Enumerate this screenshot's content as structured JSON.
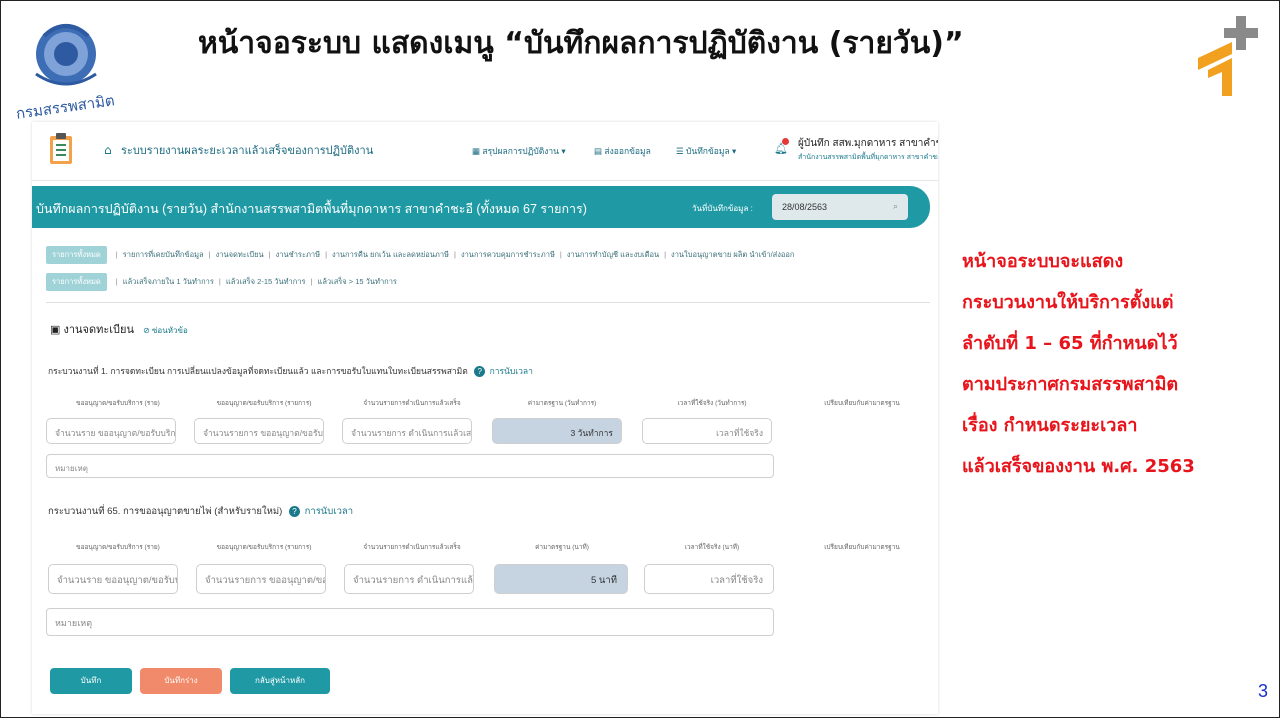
{
  "slide": {
    "title": "หน้าจอระบบ แสดงเมนู “บันทึกผลการปฏิบัติงาน (รายวัน)”",
    "seal_text": "กรมสรรพสามิต",
    "side_note": [
      "หน้าจอระบบจะแสดง",
      "กระบวนงานให้บริการตั้งแต่",
      "ลำดับที่ 1 – 65 ที่กำหนดไว้",
      "ตามประกาศกรมสรรพสามิต",
      "เรื่อง กำหนดระยะเวลา",
      "แล้วเสร็จของงาน  พ.ศ. 2563"
    ],
    "page_number": "3"
  },
  "app": {
    "system_title": "ระบบรายงานผลระยะเวลาแล้วเสร็จของการปฏิบัติงาน",
    "menu": [
      "สรุปผลการปฏิบัติงาน ▾",
      "ส่งออกข้อมูล",
      "บันทึกข้อมูล ▾"
    ],
    "user_name": "ผู้บันทึก สสพ.มุกดาหาร สาขาคำชะอี",
    "user_office": "สำนักงานสรรพสามิตพื้นที่มุกดาหาร สาขาคำชะอี",
    "banner_title": "บันทึกผลการปฏิบัติงาน (รายวัน) สำนักงานสรรพสามิตพื้นที่มุกดาหาร สาขาคำชะอี (ทั้งหมด 67 รายการ)",
    "date_label": "วันที่บันทึกข้อมูล :",
    "date_value": "28/08/2563",
    "filters_row1": [
      "รายการทั้งหมด",
      "รายการที่เคยบันทึกข้อมูล",
      "งานจดทะเบียน",
      "งานชำระภาษี",
      "งานการคืน ยกเว้น และลดหย่อนภาษี",
      "งานการควบคุมการชำระภาษี",
      "งานการทำบัญชี และงบเดือน",
      "งานใบอนุญาตขาย ผลิต นำเข้า/ส่งออก"
    ],
    "filters_row2": [
      "รายการทั้งหมด",
      "แล้วเสร็จภายใน 1 วันทำการ",
      "แล้วเสร็จ 2-15 วันทำการ",
      "แล้วเสร็จ > 15 วันทำการ"
    ],
    "section_title": "งานจดทะเบียน",
    "section_toggle": "ซ่อนหัวข้อ",
    "proc1": {
      "title": "กระบวนงานที่ 1. การจดทะเบียน การเปลี่ยนแปลงข้อมูลที่จดทะเบียนแล้ว และการขอรับใบแทนใบทะเบียนสรรพสามิต",
      "timer": "การนับเวลา",
      "headers": [
        "ขออนุญาต/ขอรับบริการ (ราย)",
        "ขออนุญาต/ขอรับบริการ (รายการ)",
        "จำนวนรายการดำเนินการแล้วเสร็จ",
        "ค่ามาตรฐาน (วันทำการ)",
        "เวลาที่ใช้จริง (วันทำการ)",
        "เปรียบเทียบกับค่ามาตรฐาน"
      ],
      "placeholders": [
        "จำนวนราย ขออนุญาต/ขอรับบริการ",
        "จำนวนรายการ ขออนุญาต/ขอรับบริการ",
        "จำนวนรายการ ดำเนินการแล้วเสร็จ"
      ],
      "standard": "3 วันทำการ",
      "actual_placeholder": "เวลาที่ใช้จริง",
      "note_placeholder": "หมายเหตุ"
    },
    "proc65": {
      "title": "กระบวนงานที่ 65. การขออนุญาตขายไพ่ (สำหรับรายใหม่)",
      "timer": "การนับเวลา",
      "headers": [
        "ขออนุญาต/ขอรับบริการ (ราย)",
        "ขออนุญาต/ขอรับบริการ (รายการ)",
        "จำนวนรายการดำเนินการแล้วเสร็จ",
        "ค่ามาตรฐาน (นาที)",
        "เวลาที่ใช้จริง (นาที)",
        "เปรียบเทียบกับค่ามาตรฐาน"
      ],
      "placeholders": [
        "จำนวนราย ขออนุญาต/ขอรับบริการ",
        "จำนวนรายการ ขออนุญาต/ขอรับบริการ",
        "จำนวนรายการ ดำเนินการแล้วเสร็จ"
      ],
      "standard": "5 นาที",
      "actual_placeholder": "เวลาที่ใช้จริง",
      "note_placeholder": "หมายเหตุ"
    },
    "buttons": [
      "บันทึก",
      "บันทึกร่าง",
      "กลับสู่หน้าหลัก"
    ]
  },
  "colors": {
    "teal": "#1f9aa5",
    "orange": "#f08a6a",
    "red_text": "#e8141b",
    "page_blue": "#1a2fd0"
  }
}
